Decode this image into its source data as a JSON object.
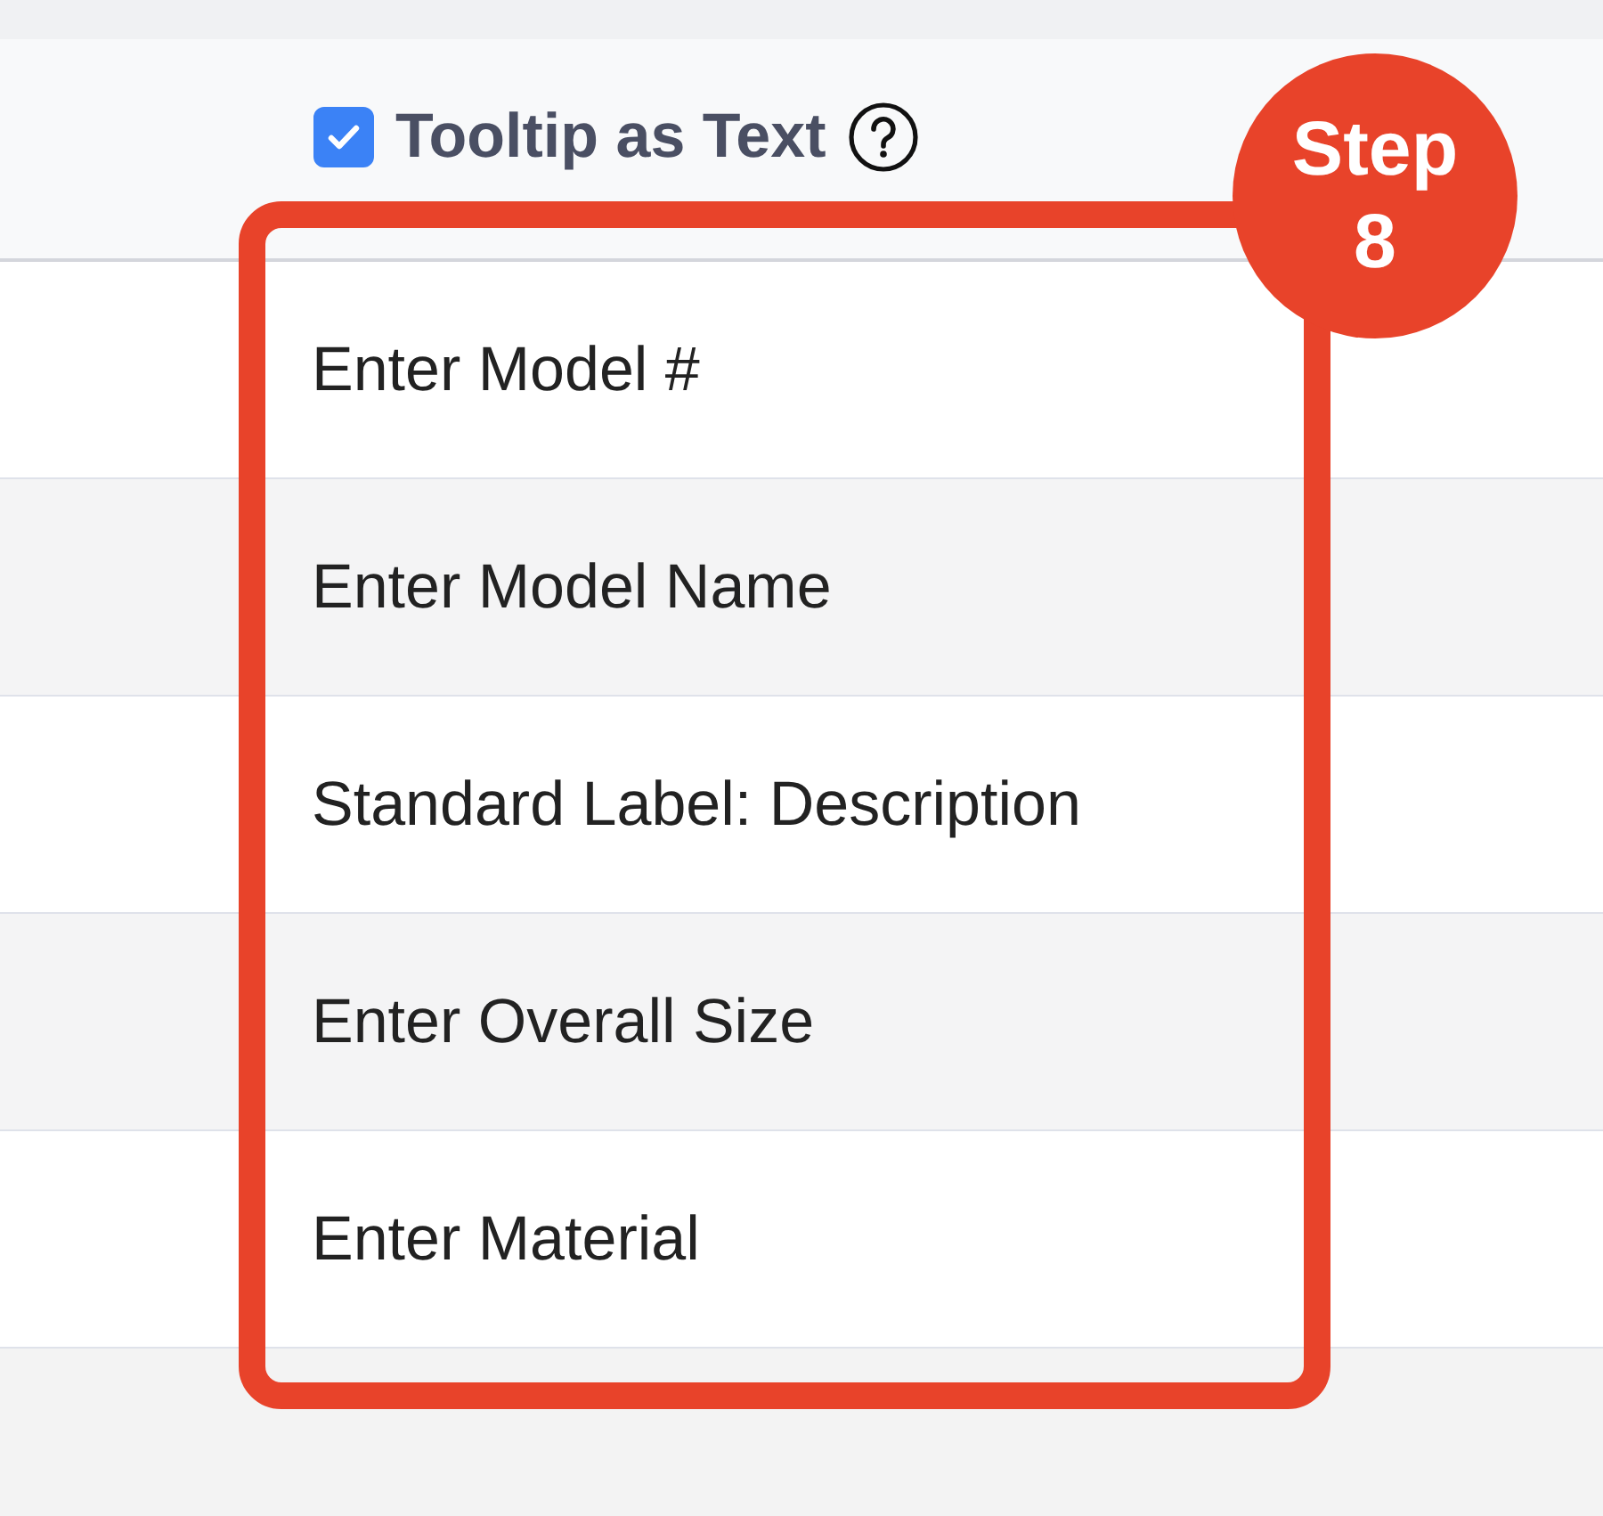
{
  "header": {
    "checkbox": {
      "label": "Tooltip as Text",
      "checked": true
    }
  },
  "rows": [
    {
      "text": "Enter Model #"
    },
    {
      "text": "Enter Model Name"
    },
    {
      "text": "Standard Label: Description"
    },
    {
      "text": "Enter Overall Size"
    },
    {
      "text": "Enter Material"
    }
  ],
  "annotation": {
    "badge": "Step 8"
  }
}
